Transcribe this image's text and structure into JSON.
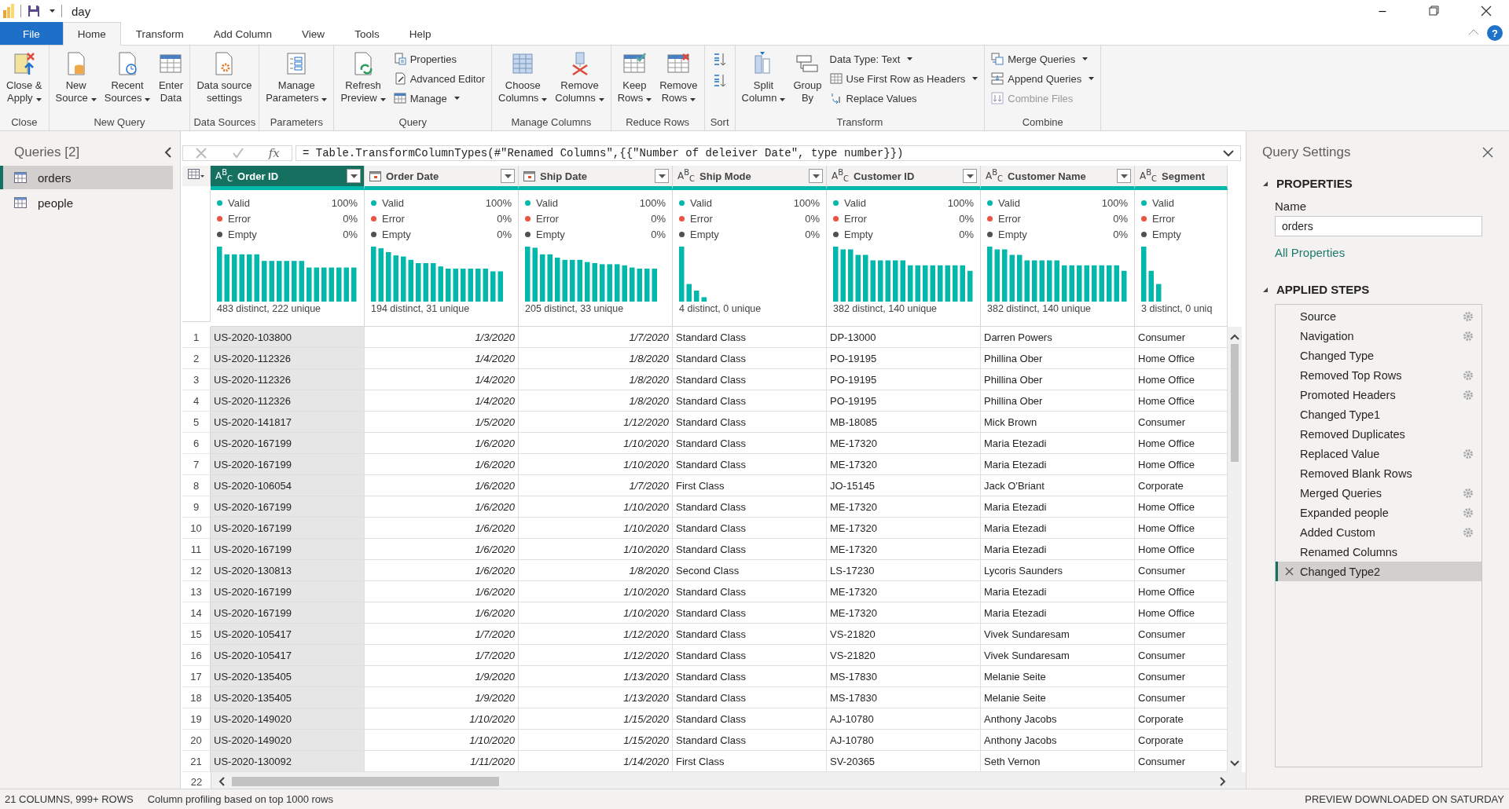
{
  "window": {
    "title": "day",
    "minimize": "–"
  },
  "ribbon": {
    "tabs": [
      {
        "label": "File",
        "kind": "file",
        "selected": false
      },
      {
        "label": "Home",
        "kind": "tab",
        "selected": true
      },
      {
        "label": "Transform",
        "kind": "tab",
        "selected": false
      },
      {
        "label": "Add Column",
        "kind": "tab",
        "selected": false
      },
      {
        "label": "View",
        "kind": "tab",
        "selected": false
      },
      {
        "label": "Tools",
        "kind": "tab",
        "selected": false
      },
      {
        "label": "Help",
        "kind": "tab",
        "selected": false
      }
    ],
    "help": "?",
    "groups": [
      {
        "label": "Close",
        "items": [
          {
            "kind": "large",
            "label": "Close &\nApply",
            "dropdown": true,
            "disabled": false
          }
        ]
      },
      {
        "label": "New Query",
        "items": [
          {
            "kind": "large",
            "label": "New\nSource",
            "dropdown": true,
            "disabled": false
          },
          {
            "kind": "large",
            "label": "Recent\nSources",
            "dropdown": true,
            "disabled": false
          },
          {
            "kind": "large",
            "label": "Enter\nData",
            "dropdown": false,
            "disabled": false
          }
        ]
      },
      {
        "label": "Data Sources",
        "items": [
          {
            "kind": "large",
            "label": "Data source\nsettings",
            "dropdown": false,
            "disabled": false
          }
        ]
      },
      {
        "label": "Parameters",
        "items": [
          {
            "kind": "large",
            "label": "Manage\nParameters",
            "dropdown": true,
            "disabled": false
          }
        ]
      },
      {
        "label": "Query",
        "items": [
          {
            "kind": "large",
            "label": "Refresh\nPreview",
            "dropdown": true,
            "disabled": false
          },
          {
            "kind": "small",
            "label": "Properties",
            "dropdown": false,
            "disabled": false
          },
          {
            "kind": "small",
            "label": "Advanced Editor",
            "dropdown": false,
            "disabled": false
          },
          {
            "kind": "small",
            "label": "Manage",
            "dropdown": true,
            "disabled": false
          }
        ]
      },
      {
        "label": "Manage Columns",
        "items": [
          {
            "kind": "large",
            "label": "Choose\nColumns",
            "dropdown": true,
            "disabled": false
          },
          {
            "kind": "large",
            "label": "Remove\nColumns",
            "dropdown": true,
            "disabled": false
          }
        ]
      },
      {
        "label": "Reduce Rows",
        "items": [
          {
            "kind": "large",
            "label": "Keep\nRows",
            "dropdown": true,
            "disabled": false
          },
          {
            "kind": "large",
            "label": "Remove\nRows",
            "dropdown": true,
            "disabled": false
          }
        ]
      },
      {
        "label": "Sort",
        "items": [
          {
            "kind": "icon",
            "disabled": false
          },
          {
            "kind": "icon",
            "disabled": false
          }
        ]
      },
      {
        "label": "Transform",
        "items": [
          {
            "kind": "large",
            "label": "Split\nColumn",
            "dropdown": true,
            "disabled": false
          },
          {
            "kind": "large",
            "label": "Group\nBy",
            "dropdown": false,
            "disabled": false
          },
          {
            "kind": "small",
            "label": "Data Type: Text",
            "dropdown": true,
            "disabled": false
          },
          {
            "kind": "small",
            "label": "Use First Row as Headers",
            "dropdown": true,
            "disabled": false
          },
          {
            "kind": "small",
            "label": "Replace Values",
            "dropdown": false,
            "disabled": false
          }
        ]
      },
      {
        "label": "Combine",
        "items": [
          {
            "kind": "small",
            "label": "Merge Queries",
            "dropdown": true,
            "disabled": false
          },
          {
            "kind": "small",
            "label": "Append Queries",
            "dropdown": true,
            "disabled": false
          },
          {
            "kind": "small",
            "label": "Combine Files",
            "dropdown": false,
            "disabled": true
          }
        ]
      }
    ]
  },
  "queries": {
    "title": "Queries [2]",
    "items": [
      {
        "label": "orders",
        "selected": true
      },
      {
        "label": "people",
        "selected": false
      }
    ]
  },
  "formula_bar": {
    "fx": "fx",
    "formula": "= Table.TransformColumnTypes(#\"Renamed Columns\",{{\"Number of deleiver Date\", type number}})"
  },
  "table": {
    "columns": [
      {
        "name": "Order ID",
        "kind": "text",
        "type_label": "A$^{B}$$_{C}$",
        "selected": true,
        "filter": true,
        "summary": "483 distinct, 222 unique",
        "profile": [
          {
            "label": "Valid",
            "value": "100%",
            "color": "#01b8aa"
          },
          {
            "label": "Error",
            "value": "0%",
            "color": "#e8543f"
          },
          {
            "label": "Empty",
            "value": "0%",
            "color": "#505050"
          }
        ]
      },
      {
        "name": "Order Date",
        "kind": "date",
        "selected": false,
        "filter": true,
        "summary": "194 distinct, 31 unique",
        "profile": [
          {
            "label": "Valid",
            "value": "100%",
            "color": "#01b8aa"
          },
          {
            "label": "Error",
            "value": "0%",
            "color": "#e8543f"
          },
          {
            "label": "Empty",
            "value": "0%",
            "color": "#505050"
          }
        ]
      },
      {
        "name": "Ship Date",
        "kind": "date",
        "selected": false,
        "filter": true,
        "summary": "205 distinct, 33 unique",
        "profile": [
          {
            "label": "Valid",
            "value": "100%",
            "color": "#01b8aa"
          },
          {
            "label": "Error",
            "value": "0%",
            "color": "#e8543f"
          },
          {
            "label": "Empty",
            "value": "0%",
            "color": "#505050"
          }
        ]
      },
      {
        "name": "Ship Mode",
        "kind": "text",
        "type_label": "A$^{B}$$_{C}$",
        "selected": false,
        "filter": true,
        "summary": "4 distinct, 0 unique",
        "profile": [
          {
            "label": "Valid",
            "value": "100%",
            "color": "#01b8aa"
          },
          {
            "label": "Error",
            "value": "0%",
            "color": "#e8543f"
          },
          {
            "label": "Empty",
            "value": "0%",
            "color": "#505050"
          }
        ]
      },
      {
        "name": "Customer ID",
        "kind": "text",
        "type_label": "A$^{B}$$_{C}$",
        "selected": false,
        "filter": true,
        "summary": "382 distinct, 140 unique",
        "profile": [
          {
            "label": "Valid",
            "value": "100%",
            "color": "#01b8aa"
          },
          {
            "label": "Error",
            "value": "0%",
            "color": "#e8543f"
          },
          {
            "label": "Empty",
            "value": "0%",
            "color": "#505050"
          }
        ]
      },
      {
        "name": "Customer Name",
        "kind": "text",
        "type_label": "A$^{B}$$_{C}$",
        "selected": false,
        "filter": true,
        "summary": "382 distinct, 140 unique",
        "profile": [
          {
            "label": "Valid",
            "value": "100%",
            "color": "#01b8aa"
          },
          {
            "label": "Error",
            "value": "0%",
            "color": "#e8543f"
          },
          {
            "label": "Empty",
            "value": "0%",
            "color": "#505050"
          }
        ]
      },
      {
        "name": "Segment",
        "kind": "text",
        "type_label": "A$^{B}$$_{C}$",
        "selected": false,
        "filter": false,
        "summary": "3 distinct, 0 uniq",
        "profile": [
          {
            "label": "Valid",
            "color": "#01b8aa"
          },
          {
            "label": "Error",
            "color": "#e8543f"
          },
          {
            "label": "Empty",
            "color": "#505050"
          }
        ]
      }
    ],
    "rows": [
      {
        "number": "1",
        "cells": [
          "US-2020-103800",
          "1/3/2020",
          "1/7/2020",
          "Standard Class",
          "DP-13000",
          "Darren Powers",
          "Consumer"
        ]
      },
      {
        "number": "2",
        "cells": [
          "US-2020-112326",
          "1/4/2020",
          "1/8/2020",
          "Standard Class",
          "PO-19195",
          "Phillina Ober",
          "Home Office"
        ]
      },
      {
        "number": "3",
        "cells": [
          "US-2020-112326",
          "1/4/2020",
          "1/8/2020",
          "Standard Class",
          "PO-19195",
          "Phillina Ober",
          "Home Office"
        ]
      },
      {
        "number": "4",
        "cells": [
          "US-2020-112326",
          "1/4/2020",
          "1/8/2020",
          "Standard Class",
          "PO-19195",
          "Phillina Ober",
          "Home Office"
        ]
      },
      {
        "number": "5",
        "cells": [
          "US-2020-141817",
          "1/5/2020",
          "1/12/2020",
          "Standard Class",
          "MB-18085",
          "Mick Brown",
          "Consumer"
        ]
      },
      {
        "number": "6",
        "cells": [
          "US-2020-167199",
          "1/6/2020",
          "1/10/2020",
          "Standard Class",
          "ME-17320",
          "Maria Etezadi",
          "Home Office"
        ]
      },
      {
        "number": "7",
        "cells": [
          "US-2020-167199",
          "1/6/2020",
          "1/10/2020",
          "Standard Class",
          "ME-17320",
          "Maria Etezadi",
          "Home Office"
        ]
      },
      {
        "number": "8",
        "cells": [
          "US-2020-106054",
          "1/6/2020",
          "1/7/2020",
          "First Class",
          "JO-15145",
          "Jack O'Briant",
          "Corporate"
        ]
      },
      {
        "number": "9",
        "cells": [
          "US-2020-167199",
          "1/6/2020",
          "1/10/2020",
          "Standard Class",
          "ME-17320",
          "Maria Etezadi",
          "Home Office"
        ]
      },
      {
        "number": "10",
        "cells": [
          "US-2020-167199",
          "1/6/2020",
          "1/10/2020",
          "Standard Class",
          "ME-17320",
          "Maria Etezadi",
          "Home Office"
        ]
      },
      {
        "number": "11",
        "cells": [
          "US-2020-167199",
          "1/6/2020",
          "1/10/2020",
          "Standard Class",
          "ME-17320",
          "Maria Etezadi",
          "Home Office"
        ]
      },
      {
        "number": "12",
        "cells": [
          "US-2020-130813",
          "1/6/2020",
          "1/8/2020",
          "Second Class",
          "LS-17230",
          "Lycoris Saunders",
          "Consumer"
        ]
      },
      {
        "number": "13",
        "cells": [
          "US-2020-167199",
          "1/6/2020",
          "1/10/2020",
          "Standard Class",
          "ME-17320",
          "Maria Etezadi",
          "Home Office"
        ]
      },
      {
        "number": "14",
        "cells": [
          "US-2020-167199",
          "1/6/2020",
          "1/10/2020",
          "Standard Class",
          "ME-17320",
          "Maria Etezadi",
          "Home Office"
        ]
      },
      {
        "number": "15",
        "cells": [
          "US-2020-105417",
          "1/7/2020",
          "1/12/2020",
          "Standard Class",
          "VS-21820",
          "Vivek Sundaresam",
          "Consumer"
        ]
      },
      {
        "number": "16",
        "cells": [
          "US-2020-105417",
          "1/7/2020",
          "1/12/2020",
          "Standard Class",
          "VS-21820",
          "Vivek Sundaresam",
          "Consumer"
        ]
      },
      {
        "number": "17",
        "cells": [
          "US-2020-135405",
          "1/9/2020",
          "1/13/2020",
          "Standard Class",
          "MS-17830",
          "Melanie Seite",
          "Consumer"
        ]
      },
      {
        "number": "18",
        "cells": [
          "US-2020-135405",
          "1/9/2020",
          "1/13/2020",
          "Standard Class",
          "MS-17830",
          "Melanie Seite",
          "Consumer"
        ]
      },
      {
        "number": "19",
        "cells": [
          "US-2020-149020",
          "1/10/2020",
          "1/15/2020",
          "Standard Class",
          "AJ-10780",
          "Anthony Jacobs",
          "Corporate"
        ]
      },
      {
        "number": "20",
        "cells": [
          "US-2020-149020",
          "1/10/2020",
          "1/15/2020",
          "Standard Class",
          "AJ-10780",
          "Anthony Jacobs",
          "Corporate"
        ]
      },
      {
        "number": "21",
        "cells": [
          "US-2020-130092",
          "1/11/2020",
          "1/14/2020",
          "First Class",
          "SV-20365",
          "Seth Vernon",
          "Consumer"
        ]
      },
      {
        "number": "22"
      }
    ]
  },
  "query_settings": {
    "title": "Query Settings",
    "properties": {
      "heading": "PROPERTIES",
      "name_label": "Name",
      "name_value": "orders",
      "link": "All Properties"
    },
    "applied_steps": {
      "heading": "APPLIED STEPS",
      "steps": [
        {
          "label": "Source",
          "settings": true,
          "selected": false
        },
        {
          "label": "Navigation",
          "settings": true,
          "selected": false
        },
        {
          "label": "Changed Type",
          "settings": false,
          "selected": false
        },
        {
          "label": "Removed Top Rows",
          "settings": true,
          "selected": false
        },
        {
          "label": "Promoted Headers",
          "settings": true,
          "selected": false
        },
        {
          "label": "Changed Type1",
          "settings": false,
          "selected": false
        },
        {
          "label": "Removed Duplicates",
          "settings": false,
          "selected": false
        },
        {
          "label": "Replaced Value",
          "settings": true,
          "selected": false
        },
        {
          "label": "Removed Blank Rows",
          "settings": false,
          "selected": false
        },
        {
          "label": "Merged Queries",
          "settings": true,
          "selected": false
        },
        {
          "label": "Expanded people",
          "settings": true,
          "selected": false
        },
        {
          "label": "Added Custom",
          "settings": true,
          "selected": false
        },
        {
          "label": "Renamed Columns",
          "settings": false,
          "selected": false
        },
        {
          "label": "Changed Type2",
          "settings": false,
          "selected": true
        }
      ]
    }
  },
  "status_bar": {
    "left": [
      "21 COLUMNS, 999+ ROWS",
      "Column profiling based on top 1000 rows"
    ],
    "right": "PREVIEW DOWNLOADED ON SATURDAY"
  }
}
